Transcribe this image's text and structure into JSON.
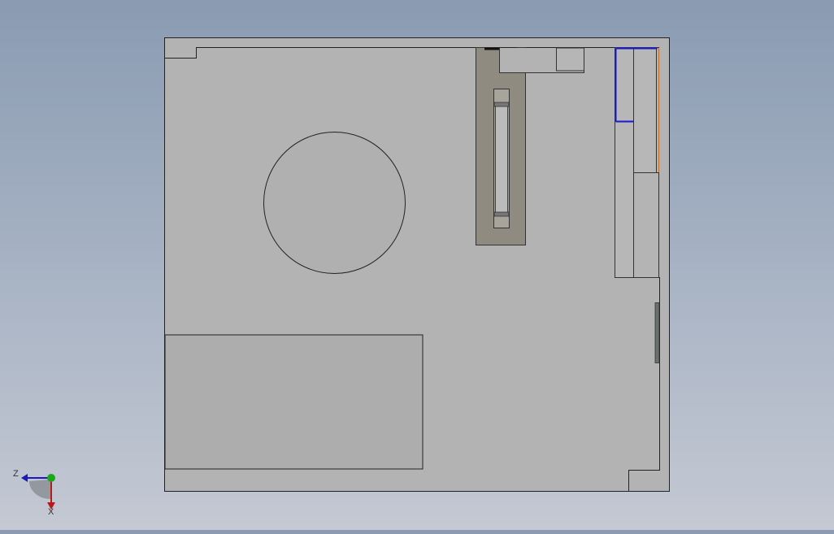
{
  "view": {
    "orientation": "top"
  },
  "triad": {
    "axis_z_label": "Z",
    "axis_x_label": "X",
    "axis_z_color": "#1a1ab8",
    "axis_x_color": "#b81a1a",
    "axis_y_color": "#1aa81a"
  },
  "model": {
    "face_color": "#b3b3b3",
    "edge_color": "#222222",
    "rail_color": "#8f8b80",
    "highlight_color": "#1a1acc"
  }
}
